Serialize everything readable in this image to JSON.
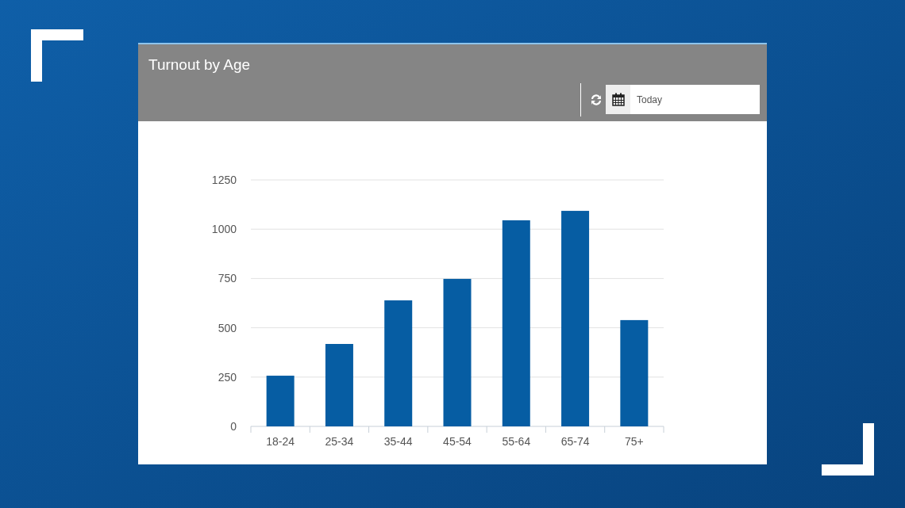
{
  "panel": {
    "title": "Turnout by Age",
    "date_field": {
      "value": "Today"
    },
    "chart_data": {
      "type": "bar",
      "grid": true,
      "categories": [
        "18-24",
        "25-34",
        "35-44",
        "45-54",
        "55-64",
        "65-74",
        "75+"
      ],
      "series": [
        {
          "color": "#065da3",
          "values": [
            257,
            418,
            639,
            748,
            1045,
            1093,
            539
          ]
        }
      ],
      "ylim": [
        0,
        1250
      ],
      "yticks": [
        0,
        250,
        500,
        750,
        1000,
        1250
      ]
    }
  }
}
